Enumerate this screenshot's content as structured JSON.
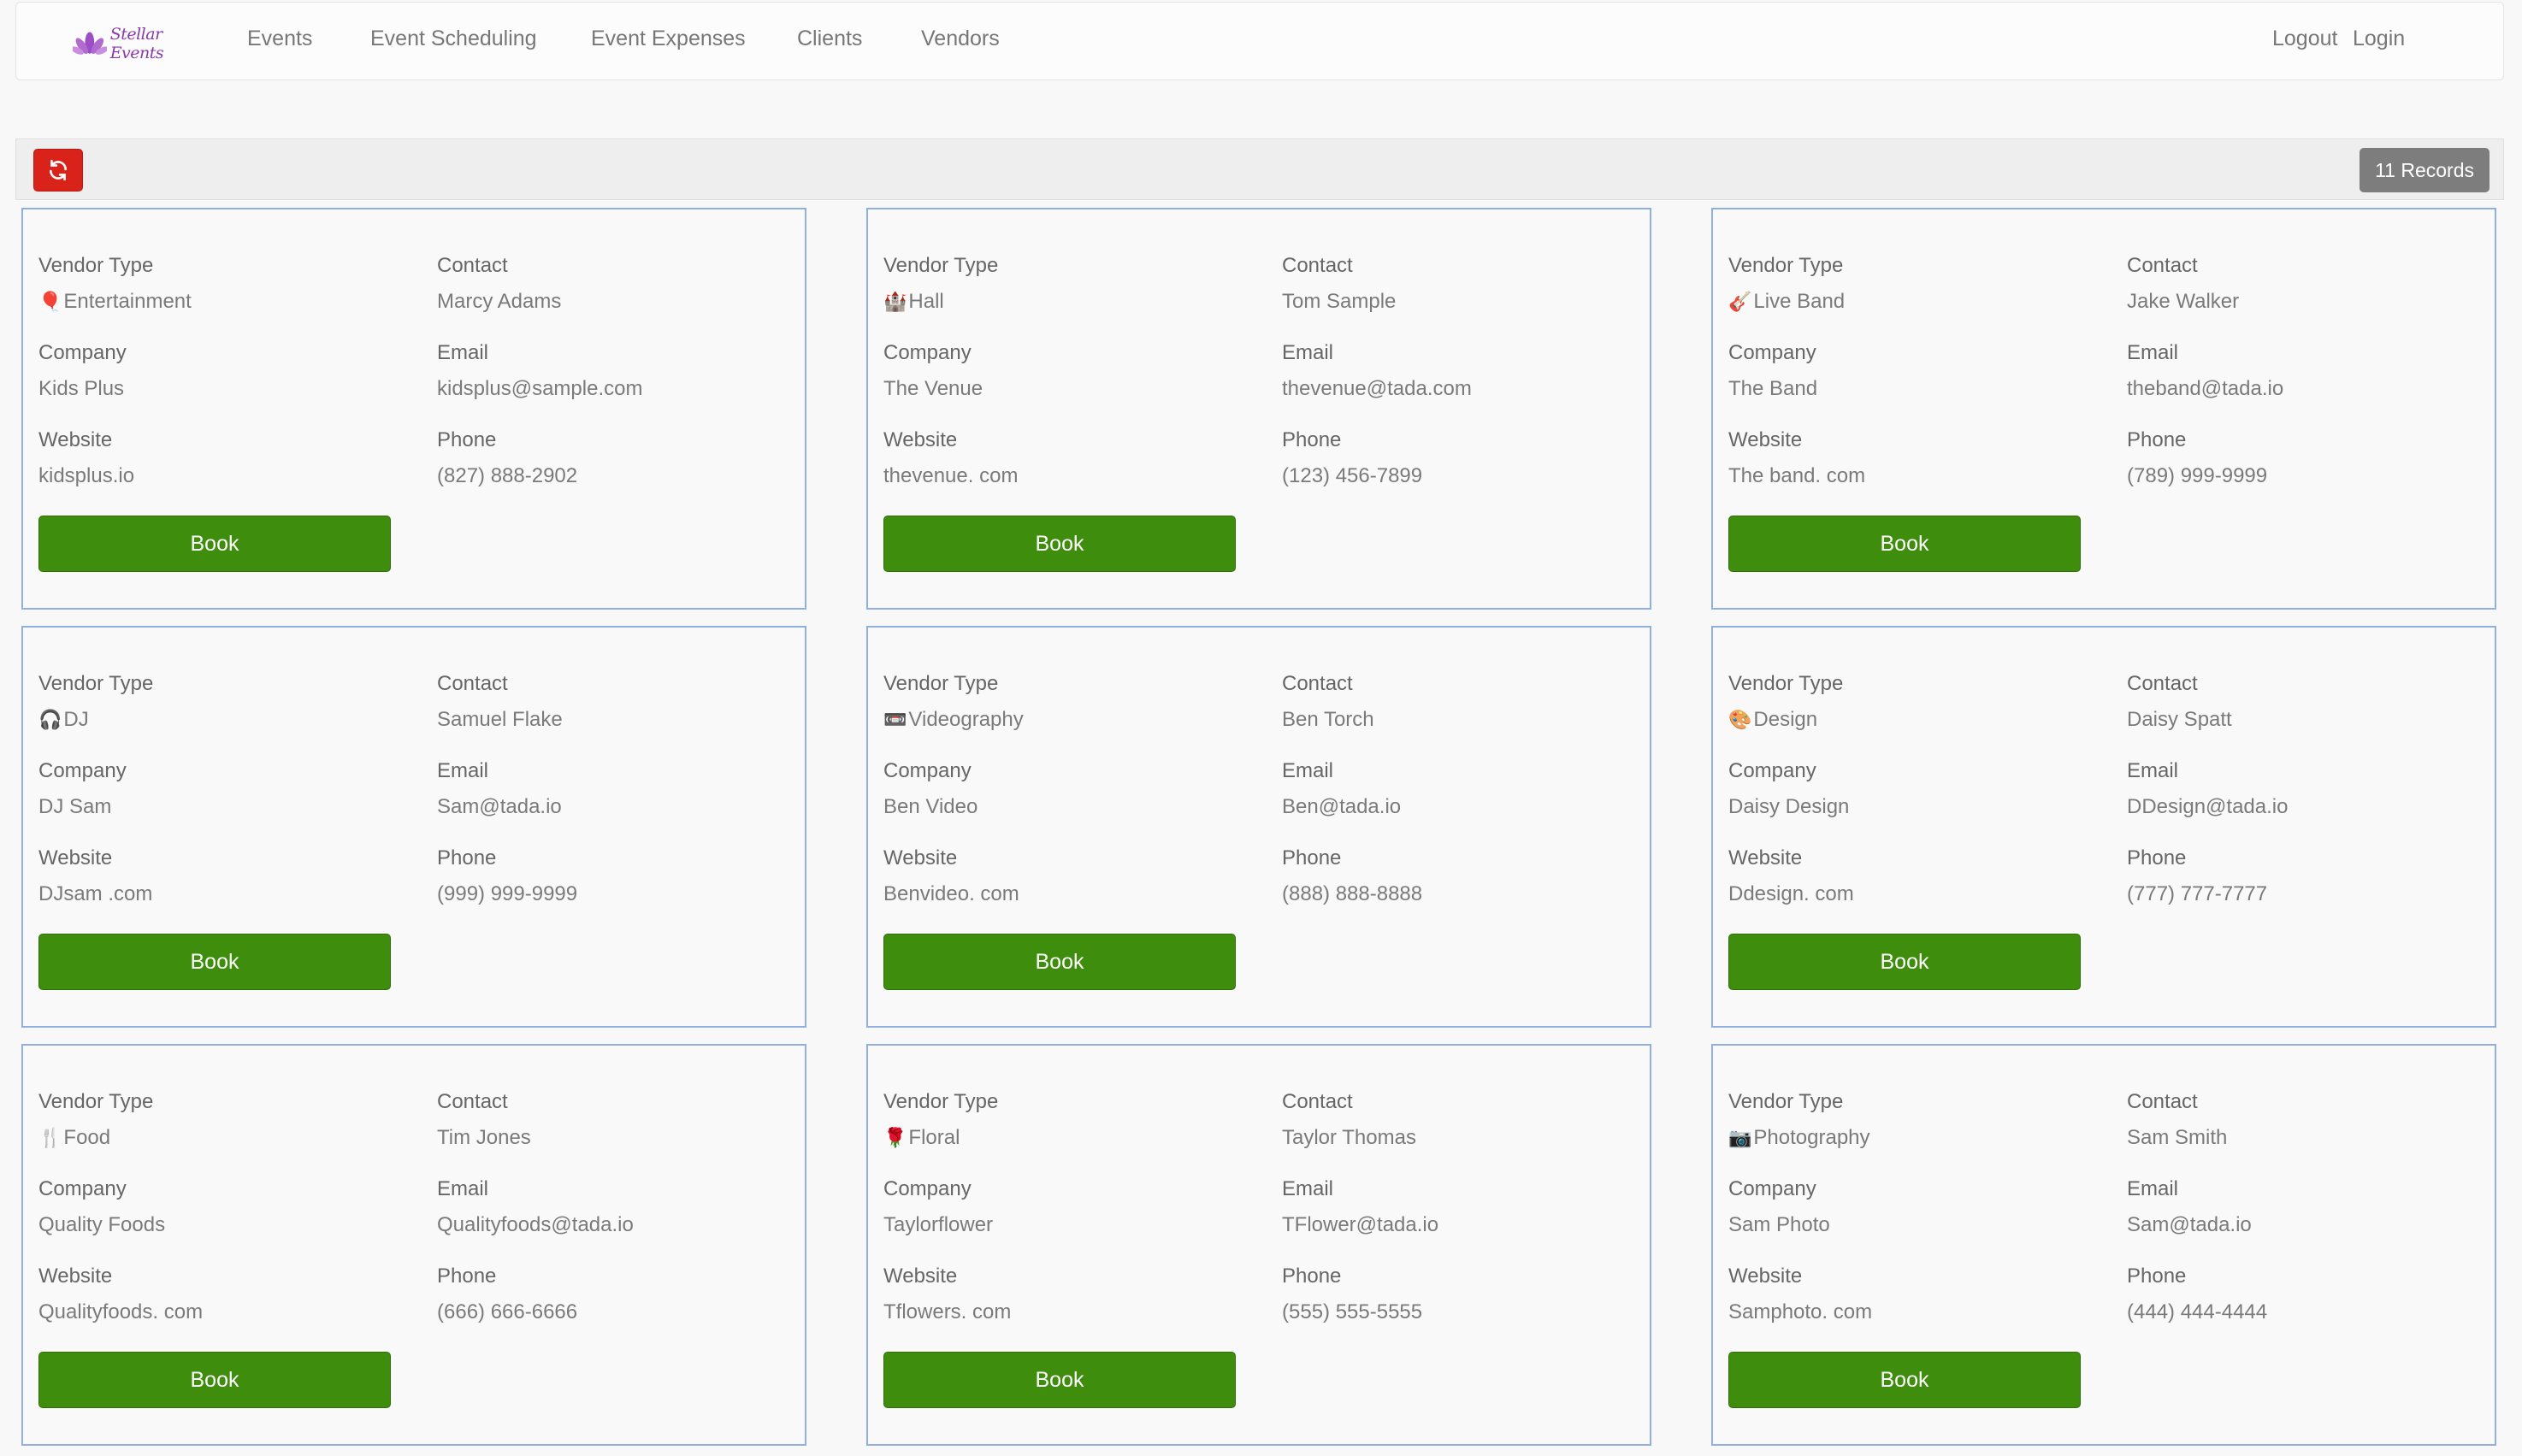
{
  "brand": {
    "name": "Stellar Events"
  },
  "nav": {
    "items": [
      "Events",
      "Event Scheduling",
      "Event Expenses",
      "Clients",
      "Vendors"
    ],
    "right": [
      "Logout",
      "Login"
    ]
  },
  "toolbar": {
    "records": "11 Records",
    "refresh_icon": "refresh-icon"
  },
  "labels": {
    "vendor_type": "Vendor Type",
    "contact": "Contact",
    "company": "Company",
    "email": "Email",
    "website": "Website",
    "phone": "Phone",
    "book": "Book"
  },
  "vendors": [
    {
      "icon": "🎈",
      "icon_name": "balloon-icon",
      "type": "Entertainment",
      "contact": "Marcy Adams",
      "company": "Kids Plus",
      "email": "kidsplus@sample.com",
      "website": "kidsplus.io",
      "phone": "(827) 888-2902"
    },
    {
      "icon": "🏰",
      "icon_name": "castle-icon",
      "type": "Hall",
      "contact": "Tom Sample",
      "company": "The Venue",
      "email": "thevenue@tada.com",
      "website": "thevenue. com",
      "phone": "(123) 456-7899"
    },
    {
      "icon": "🎸",
      "icon_name": "guitar-icon",
      "type": "Live Band",
      "contact": "Jake Walker",
      "company": "The Band",
      "email": "theband@tada.io",
      "website": "The band. com",
      "phone": "(789) 999-9999"
    },
    {
      "icon": "🎧",
      "icon_name": "headphones-icon",
      "type": "DJ",
      "contact": "Samuel Flake",
      "company": "DJ Sam",
      "email": "Sam@tada.io",
      "website": "DJsam .com",
      "phone": "(999) 999-9999"
    },
    {
      "icon": "📼",
      "icon_name": "videotape-icon",
      "type": "Videography",
      "contact": "Ben Torch",
      "company": "Ben Video",
      "email": "Ben@tada.io",
      "website": "Benvideo. com",
      "phone": "(888) 888-8888"
    },
    {
      "icon": "🎨",
      "icon_name": "palette-icon",
      "type": "Design",
      "contact": "Daisy Spatt",
      "company": "Daisy Design",
      "email": "DDesign@tada.io",
      "website": "Ddesign. com",
      "phone": "(777) 777-7777"
    },
    {
      "icon": "🍴",
      "icon_name": "fork-knife-icon",
      "type": "Food",
      "contact": "Tim Jones",
      "company": "Quality Foods",
      "email": "Qualityfoods@tada.io",
      "website": "Qualityfoods. com",
      "phone": "(666) 666-6666"
    },
    {
      "icon": "🌹",
      "icon_name": "rose-icon",
      "type": "Floral",
      "contact": "Taylor Thomas",
      "company": "Taylorflower",
      "email": "TFlower@tada.io",
      "website": "Tflowers. com",
      "phone": "(555) 555-5555"
    },
    {
      "icon": "📷",
      "icon_name": "camera-icon",
      "type": "Photography",
      "contact": "Sam Smith",
      "company": "Sam Photo",
      "email": "Sam@tada.io",
      "website": "Samphoto. com",
      "phone": "(444) 444-4444"
    }
  ]
}
